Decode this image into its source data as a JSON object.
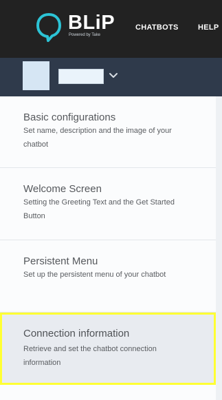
{
  "header": {
    "logo_text": "BLiP",
    "logo_subtitle": "Powered by Take",
    "nav": {
      "chatbots": "CHATBOTS",
      "help": "HELP"
    }
  },
  "subheader": {
    "bot_selector_icon": "chevron-down-icon"
  },
  "menu": {
    "items": [
      {
        "title": "Basic configurations",
        "description": "Set name, description and the image of your chatbot"
      },
      {
        "title": "Welcome Screen",
        "description": "Setting the Greeting Text and the Get Started Button"
      },
      {
        "title": "Persistent Menu",
        "description": "Set up the persistent menu of your chatbot"
      },
      {
        "title": "Connection information",
        "description": "Retrieve and set the chatbot connection information",
        "highlighted": true
      }
    ]
  },
  "colors": {
    "topbar": "#222222",
    "subbar": "#2f3a4b",
    "logo_accent": "#2cc3d5",
    "highlight_border": "#ffff33"
  }
}
